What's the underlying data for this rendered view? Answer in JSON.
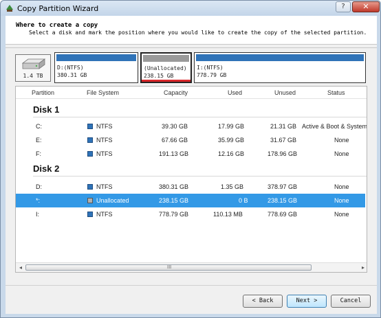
{
  "window": {
    "title": "Copy Partition Wizard",
    "help_label": "?",
    "close_label": "✕"
  },
  "header": {
    "title": "Where to create a copy",
    "subtitle": "Select a disk and mark the position where you would like to create the copy of the selected partition."
  },
  "disk_map": {
    "disk_size": "1.4 TB",
    "partitions": [
      {
        "line1": "D:(NTFS)",
        "line2": "380.31 GB"
      },
      {
        "line1": "(Unallocated)",
        "line2": "238.15 GB"
      },
      {
        "line1": "I:(NTFS)",
        "line2": "778.79 GB"
      }
    ]
  },
  "table": {
    "columns": [
      "Partition",
      "File System",
      "Capacity",
      "Used",
      "Unused",
      "Status"
    ],
    "disks": [
      {
        "label": "Disk 1",
        "rows": [
          {
            "partition": "C:",
            "fs": "NTFS",
            "capacity": "39.30 GB",
            "used": "17.99 GB",
            "unused": "21.31 GB",
            "status": "Active & Boot & System"
          },
          {
            "partition": "E:",
            "fs": "NTFS",
            "capacity": "67.66 GB",
            "used": "35.99 GB",
            "unused": "31.67 GB",
            "status": "None"
          },
          {
            "partition": "F:",
            "fs": "NTFS",
            "capacity": "191.13 GB",
            "used": "12.16 GB",
            "unused": "178.96 GB",
            "status": "None"
          }
        ]
      },
      {
        "label": "Disk 2",
        "rows": [
          {
            "partition": "D:",
            "fs": "NTFS",
            "capacity": "380.31 GB",
            "used": "1.35 GB",
            "unused": "378.97 GB",
            "status": "None"
          },
          {
            "partition": "*:",
            "fs": "Unallocated",
            "capacity": "238.15 GB",
            "used": "0 B",
            "unused": "238.15 GB",
            "status": "None"
          },
          {
            "partition": "I:",
            "fs": "NTFS",
            "capacity": "778.79 GB",
            "used": "110.13 MB",
            "unused": "778.69 GB",
            "status": "None"
          }
        ]
      }
    ],
    "selected_row": "*:"
  },
  "scrollbar": {
    "left_arrow": "◂",
    "right_arrow": "▸",
    "grip": "III"
  },
  "buttons": {
    "back": "< Back",
    "next": "Next >",
    "cancel": "Cancel"
  },
  "colors": {
    "ntfs": "#2f73b8",
    "unallocated": "#9a9a9a",
    "selection": "#3399e6",
    "marker": "#d9262a"
  }
}
